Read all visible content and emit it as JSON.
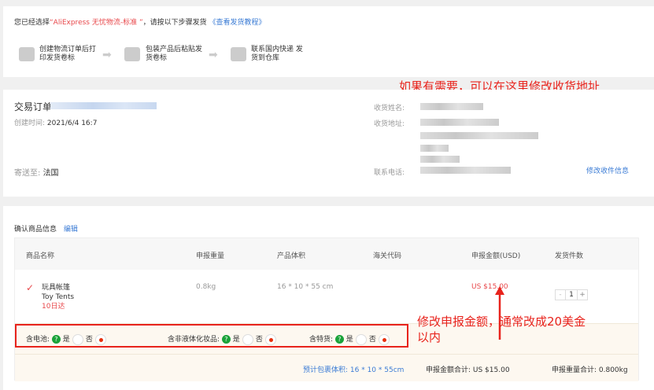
{
  "intro": {
    "prefix": "您已经选择",
    "service": "“AliExpress 无忧物流-标准 ”",
    "suffix": "，请按以下步骤发货",
    "tutorial_link": "《查看发货教程》"
  },
  "steps": [
    {
      "icon": "printer-icon",
      "label1": "创建物流订单后打",
      "label2": "印发货卷标"
    },
    {
      "icon": "package-icon",
      "label1": "包装产品后粘贴发",
      "label2": "货卷标"
    },
    {
      "icon": "truck-icon",
      "label1": "联系国内快递 发",
      "label2": "货到仓库"
    }
  ],
  "order": {
    "title": "交易订单",
    "created_label": "创建时间:",
    "created_value": "2021/6/4 16:7",
    "ship_to_label": "寄送至:",
    "ship_to_value": "法国"
  },
  "recipient": {
    "name_label": "收货姓名:",
    "address_label": "收货地址:",
    "phone_label": "联系电话:",
    "edit_link": "修改收件信息"
  },
  "annotations": {
    "address": "如果有需要，可以在这里修改收货地址",
    "amount_line1": "修改申报金额，通常改成20美金",
    "amount_line2": "以内"
  },
  "products": {
    "title": "确认商品信息",
    "edit_link": "编辑",
    "columns": [
      "商品名称",
      "申报重量",
      "产品体积",
      "海关代码",
      "申报金额(USD)",
      "发货件数"
    ],
    "row": {
      "name_cn": "玩具帐篷",
      "name_en": "Toy Tents",
      "delivery": "10日达",
      "weight": "0.8kg",
      "volume": "16 * 10 * 55 cm",
      "hs_code": "",
      "amount": "US $15.00",
      "quantity": "1"
    },
    "attributes": [
      {
        "label": "含电池:",
        "yes": "是",
        "no": "否",
        "selected": "no"
      },
      {
        "label": "含非液体化妆品:",
        "yes": "是",
        "no": "否",
        "selected": "no"
      },
      {
        "label": "含特货:",
        "yes": "是",
        "no": "否",
        "selected": "no"
      }
    ],
    "totals": {
      "volume": "预计包裹体积: 16 * 10 * 55cm",
      "amount": "申报金额合计: US $15.00",
      "weight": "申报重量合计: 0.800kg"
    }
  },
  "colors": {
    "accent": "#e8484b",
    "link": "#3a7bd5",
    "annotation": "#e8231c"
  }
}
